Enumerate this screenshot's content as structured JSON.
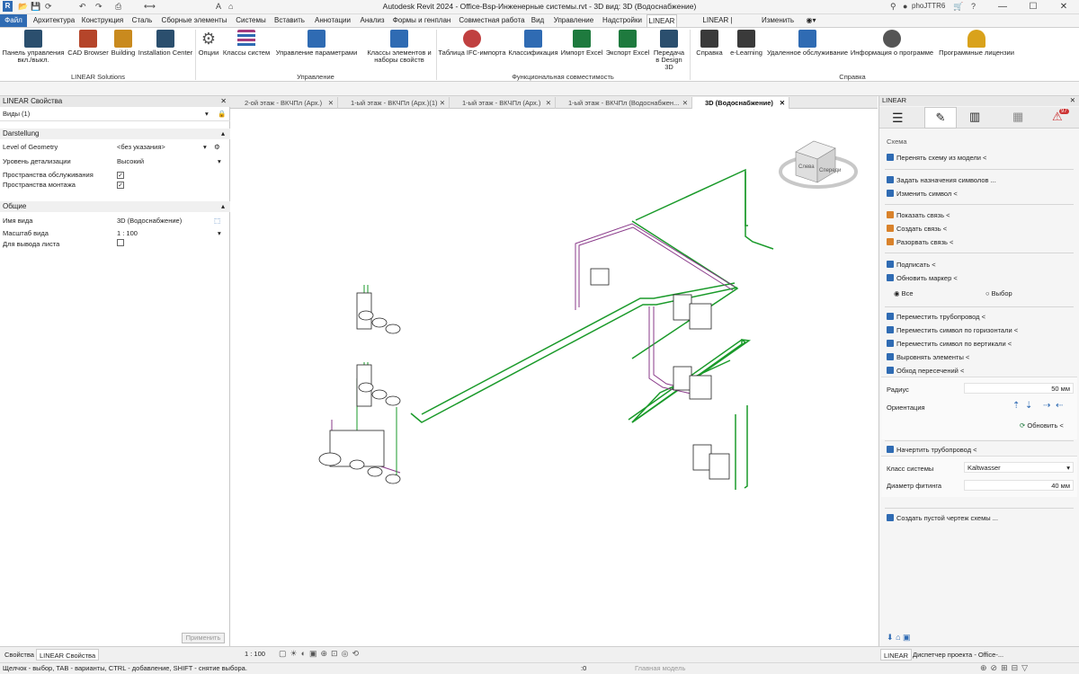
{
  "titlebar": {
    "title": "Autodesk Revit 2024 - Office-Bsp-Инженерные системы.rvt - 3D вид: 3D (Водоснабжение)",
    "user": "phoJTTR6"
  },
  "ribbon_tabs": [
    "Файл",
    "Архитектура",
    "Конструкция",
    "Сталь",
    "Сборные элементы",
    "Системы",
    "Вставить",
    "Аннотации",
    "Анализ",
    "Формы и генплан",
    "Совместная работа",
    "Вид",
    "Управление",
    "Надстройки",
    "LINEAR",
    "LINEAR | Инструменты",
    "Изменить"
  ],
  "active_tab": "LINEAR",
  "ribbon": {
    "buttons": [
      {
        "label": "Панель управления вкл./выкл.",
        "icon": "linear-panel-icon",
        "color": "#2b4f6e"
      },
      {
        "label": "CAD Browser",
        "icon": "cad-browser-icon",
        "color": "#b5452a"
      },
      {
        "label": "Building",
        "icon": "building-icon",
        "color": "#c98a1e"
      },
      {
        "label": "Installation Center",
        "icon": "installation-center-icon",
        "color": "#2b4f6e"
      },
      {
        "label": "Опции",
        "icon": "gears-icon",
        "color": "#555555"
      },
      {
        "label": "Классы систем",
        "icon": "system-classes-icon",
        "color": "#a23a7c"
      },
      {
        "label": "Управление параметрами",
        "icon": "parameters-icon",
        "color": "#2f6bb3"
      },
      {
        "label": "Классы элементов и наборы свойств",
        "icon": "element-classes-icon",
        "color": "#2f6bb3"
      },
      {
        "label": "Таблица IFC-импорта",
        "icon": "ifc-table-icon",
        "color": "#c04040"
      },
      {
        "label": "Классификация",
        "icon": "classification-icon",
        "color": "#2f6bb3"
      },
      {
        "label": "Импорт Excel",
        "icon": "excel-import-icon",
        "color": "#1e7a3e"
      },
      {
        "label": "Экспорт Excel",
        "icon": "excel-export-icon",
        "color": "#1e7a3e"
      },
      {
        "label": "Передача в Design 3D",
        "icon": "design3d-icon",
        "color": "#2b4f6e"
      },
      {
        "label": "Справка",
        "icon": "help-book-icon",
        "color": "#3a3a3a"
      },
      {
        "label": "e-Learning",
        "icon": "graduation-cap-icon",
        "color": "#3a3a3a"
      },
      {
        "label": "Удаленное обслуживание",
        "icon": "remote-support-icon",
        "color": "#2f6bb3"
      },
      {
        "label": "Информация о программе",
        "icon": "info-icon",
        "color": "#555555"
      },
      {
        "label": "Программные лицензии",
        "icon": "key-icon",
        "color": "#d9a21b"
      }
    ],
    "panels": [
      "LINEAR Solutions",
      "Управление",
      "Функциональная совместимость",
      "Справка"
    ]
  },
  "properties": {
    "header": "LINEAR Свойства",
    "selector": "Виды (1)",
    "section1": "Darstellung",
    "rows1": [
      {
        "key": "Level of Geometry",
        "value": "<без указания>"
      },
      {
        "key": "Уровень детализации",
        "value": "Высокий"
      },
      {
        "key": "Пространства обслуживания",
        "value": "✓"
      },
      {
        "key": "Пространства монтажа",
        "value": "✓"
      }
    ],
    "section2": "Общие",
    "rows2": [
      {
        "key": "Имя вида",
        "value": "3D (Водоснабжение)"
      },
      {
        "key": "Масштаб вида",
        "value": "1 : 100"
      },
      {
        "key": "Для вывода листа",
        "value": ""
      }
    ],
    "apply": "Применить",
    "bottom_tabs": [
      "Свойства",
      "LINEAR Свойства"
    ]
  },
  "view_tabs": [
    "2-ой этаж - ВКЧПл (Арх.)",
    "1-ый этаж - ВКЧПл (Арх.)(1)",
    "1-ый этаж - ВКЧПл (Арх.)",
    "1-ый этаж - ВКЧПл (Водоснабжен...",
    "3D (Водоснабжение)"
  ],
  "viewcube": {
    "left": "Слева",
    "front": "Спереди"
  },
  "view_scale": "1 : 100",
  "right_panel": {
    "header": "LINEAR",
    "badge": "97",
    "section": "Схема",
    "items": [
      {
        "label": "Перенять схему из модели <",
        "color": "#2f6bb3"
      },
      {
        "label": "Задать назначения символов ...",
        "color": "#2f6bb3"
      },
      {
        "label": "Изменить символ <",
        "color": "#2f6bb3"
      },
      {
        "label": "Показать связь <",
        "color": "#d9822b"
      },
      {
        "label": "Создать связь <",
        "color": "#d9822b"
      },
      {
        "label": "Разорвать связь <",
        "color": "#d9822b"
      },
      {
        "label": "Подписать <",
        "color": "#2f6bb3"
      },
      {
        "label": "Обновить маркер <",
        "color": "#2f6bb3"
      },
      {
        "label": "Переместить трубопровод <",
        "color": "#2f6bb3"
      },
      {
        "label": "Переместить символ по горизонтали <",
        "color": "#2f6bb3"
      },
      {
        "label": "Переместить символ по вертикали <",
        "color": "#2f6bb3"
      },
      {
        "label": "Выровнять элементы <",
        "color": "#2f6bb3"
      },
      {
        "label": "Обход пересечений <",
        "color": "#2f6bb3"
      },
      {
        "label": "Начертить трубопровод <",
        "color": "#2f6bb3"
      },
      {
        "label": "Создать пустой чертеж схемы ...",
        "color": "#2f6bb3"
      }
    ],
    "radio_all": "Все",
    "radio_selection": "Выбор",
    "radius_label": "Радиус",
    "radius_value": "50 мм",
    "orientation_label": "Ориентация",
    "refresh": "Обновить <",
    "system_class_label": "Класс системы",
    "system_class_value": "Kaltwasser",
    "fitting_label": "Диаметр фитинга",
    "fitting_value": "40 мм",
    "bottom_tabs": [
      "LINEAR",
      "Диспетчер проекта - Office-..."
    ]
  },
  "status": {
    "text": "Щелчок - выбор, TAB - варианты, CTRL - добавление, SHIFT - снятие выбора.",
    "model": "Главная модель",
    "zero": ":0"
  }
}
